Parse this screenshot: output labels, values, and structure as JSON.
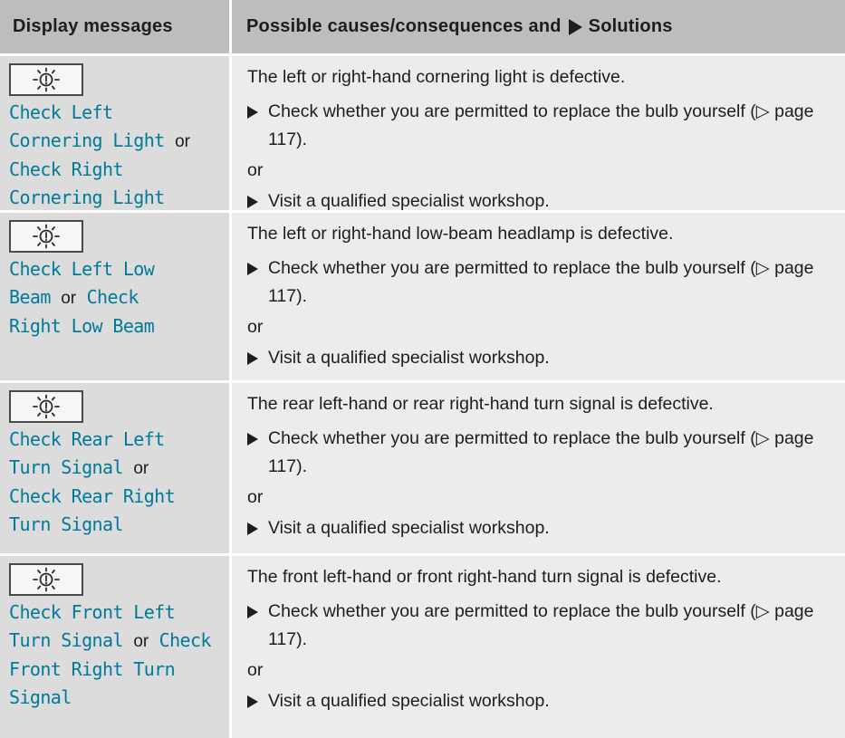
{
  "header": {
    "display_messages": "Display messages",
    "causes_prefix": "Possible causes/consequences and",
    "causes_suffix": "Solutions"
  },
  "rows": [
    {
      "msg_part1": "Check Left Cornering Light",
      "or_word": "or",
      "msg_part2": "Check Right Cornering Light",
      "cause": "The left or right-hand cornering light is defective.",
      "step1": "Check whether you are permitted to replace the bulb yourself (▷ page 117).",
      "or_line": "or",
      "step2": "Visit a qualified specialist workshop."
    },
    {
      "msg_part1": "Check Left Low Beam",
      "or_word": "or",
      "msg_part2": "Check Right Low Beam",
      "cause": "The left or right-hand low-beam headlamp is defective.",
      "step1": "Check whether you are permitted to replace the bulb yourself (▷ page 117).",
      "or_line": "or",
      "step2": "Visit a qualified specialist workshop."
    },
    {
      "msg_part1": "Check Rear Left Turn Signal",
      "or_word": "or",
      "msg_part2": "Check Rear Right Turn Signal",
      "cause": "The rear left-hand or rear right-hand turn signal is defective.",
      "step1": "Check whether you are permitted to replace the bulb yourself (▷ page 117).",
      "or_line": "or",
      "step2": "Visit a qualified specialist workshop."
    },
    {
      "msg_part1": "Check Front Left Turn Signal",
      "or_word": "or",
      "msg_part2": "Check Front Right Turn Signal",
      "cause": "The front left-hand or front right-hand turn signal is defective.",
      "step1": "Check whether you are permitted to replace the bulb yourself (▷ page 117).",
      "or_line": "or",
      "step2": "Visit a qualified specialist workshop."
    }
  ],
  "icon": "bulb-failure-warning-icon",
  "colors": {
    "header_bg": "#bdbdbd",
    "left_col_bg": "#dcdcdc",
    "right_col_bg": "#ececec",
    "message_text": "#007a98"
  }
}
